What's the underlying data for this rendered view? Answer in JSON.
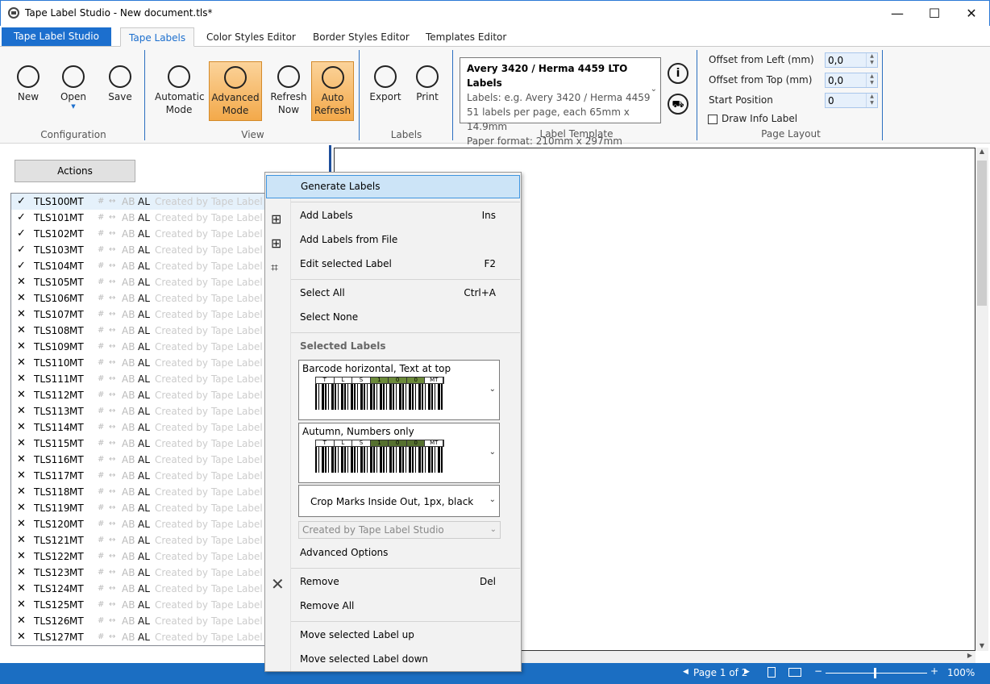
{
  "window": {
    "title": "Tape Label Studio - New document.tls*",
    "minimize": "—",
    "maximize": "☐",
    "close": "✕"
  },
  "tabs": {
    "app": "Tape Label Studio",
    "items": [
      "Tape Labels",
      "Color Styles Editor",
      "Border Styles Editor",
      "Templates Editor"
    ]
  },
  "ribbon": {
    "configuration": {
      "label": "Configuration",
      "new": "New",
      "open": "Open",
      "save": "Save"
    },
    "view": {
      "label": "View",
      "automatic": [
        "Automatic",
        "Mode"
      ],
      "advanced": [
        "Advanced",
        "Mode"
      ],
      "refresh": [
        "Refresh",
        "Now"
      ],
      "auto_refresh": [
        "Auto",
        "Refresh"
      ]
    },
    "labels": {
      "label": "Labels",
      "export": "Export",
      "print": "Print"
    },
    "template": {
      "label": "Label Template",
      "title": "Avery 3420 / Herma 4459 LTO Labels",
      "line1": "Labels: e.g. Avery 3420 / Herma 4459",
      "line2": "51 labels per page, each 65mm x 14.9mm",
      "line3": "Paper format: 210mm x 297mm"
    },
    "layout": {
      "label": "Page Layout",
      "offset_left_label": "Offset from Left (mm)",
      "offset_left": "0,0",
      "offset_top_label": "Offset from Top (mm)",
      "offset_top": "0,0",
      "start_label": "Start Position",
      "start": "0",
      "draw_info": "Draw Info Label"
    }
  },
  "left": {
    "actions": "Actions",
    "rows": [
      {
        "mark": "✓",
        "id": "TLS100",
        "type": "MT"
      },
      {
        "mark": "✓",
        "id": "TLS101",
        "type": "MT"
      },
      {
        "mark": "✓",
        "id": "TLS102",
        "type": "MT"
      },
      {
        "mark": "✓",
        "id": "TLS103",
        "type": "MT"
      },
      {
        "mark": "✓",
        "id": "TLS104",
        "type": "MT"
      },
      {
        "mark": "✕",
        "id": "TLS105",
        "type": "MT"
      },
      {
        "mark": "✕",
        "id": "TLS106",
        "type": "MT"
      },
      {
        "mark": "✕",
        "id": "TLS107",
        "type": "MT"
      },
      {
        "mark": "✕",
        "id": "TLS108",
        "type": "MT"
      },
      {
        "mark": "✕",
        "id": "TLS109",
        "type": "MT"
      },
      {
        "mark": "✕",
        "id": "TLS110",
        "type": "MT"
      },
      {
        "mark": "✕",
        "id": "TLS111",
        "type": "MT"
      },
      {
        "mark": "✕",
        "id": "TLS112",
        "type": "MT"
      },
      {
        "mark": "✕",
        "id": "TLS113",
        "type": "MT"
      },
      {
        "mark": "✕",
        "id": "TLS114",
        "type": "MT"
      },
      {
        "mark": "✕",
        "id": "TLS115",
        "type": "MT"
      },
      {
        "mark": "✕",
        "id": "TLS116",
        "type": "MT"
      },
      {
        "mark": "✕",
        "id": "TLS117",
        "type": "MT"
      },
      {
        "mark": "✕",
        "id": "TLS118",
        "type": "MT"
      },
      {
        "mark": "✕",
        "id": "TLS119",
        "type": "MT"
      },
      {
        "mark": "✕",
        "id": "TLS120",
        "type": "MT"
      },
      {
        "mark": "✕",
        "id": "TLS121",
        "type": "MT"
      },
      {
        "mark": "✕",
        "id": "TLS122",
        "type": "MT"
      },
      {
        "mark": "✕",
        "id": "TLS123",
        "type": "MT"
      },
      {
        "mark": "✕",
        "id": "TLS124",
        "type": "MT"
      },
      {
        "mark": "✕",
        "id": "TLS125",
        "type": "MT"
      },
      {
        "mark": "✕",
        "id": "TLS126",
        "type": "MT"
      },
      {
        "mark": "✕",
        "id": "TLS127",
        "type": "MT"
      }
    ],
    "ab": "AB",
    "al": "AL",
    "created": "Created by Tape Label Stu"
  },
  "menu": {
    "generate": "Generate Labels",
    "add": "Add Labels",
    "add_key": "Ins",
    "add_file": "Add Labels from File",
    "edit": "Edit selected Label",
    "edit_key": "F2",
    "select_all": "Select All",
    "select_all_key": "Ctrl+A",
    "select_none": "Select None",
    "selected_header": "Selected Labels",
    "style1": "Barcode horizontal, Text at top",
    "style2": "Autumn, Numbers only",
    "border": "Crop Marks Inside Out, 1px, black",
    "info": "Created by Tape Label Studio",
    "advanced": "Advanced Options",
    "remove": "Remove",
    "remove_key": "Del",
    "remove_all": "Remove All",
    "move_up": "Move selected Label up",
    "move_down": "Move selected Label down",
    "barcode_chars": [
      "T",
      "L",
      "S",
      "1",
      "0",
      "0",
      "MT"
    ]
  },
  "status": {
    "page": "Page 1 of 2",
    "zoom": "100%"
  }
}
